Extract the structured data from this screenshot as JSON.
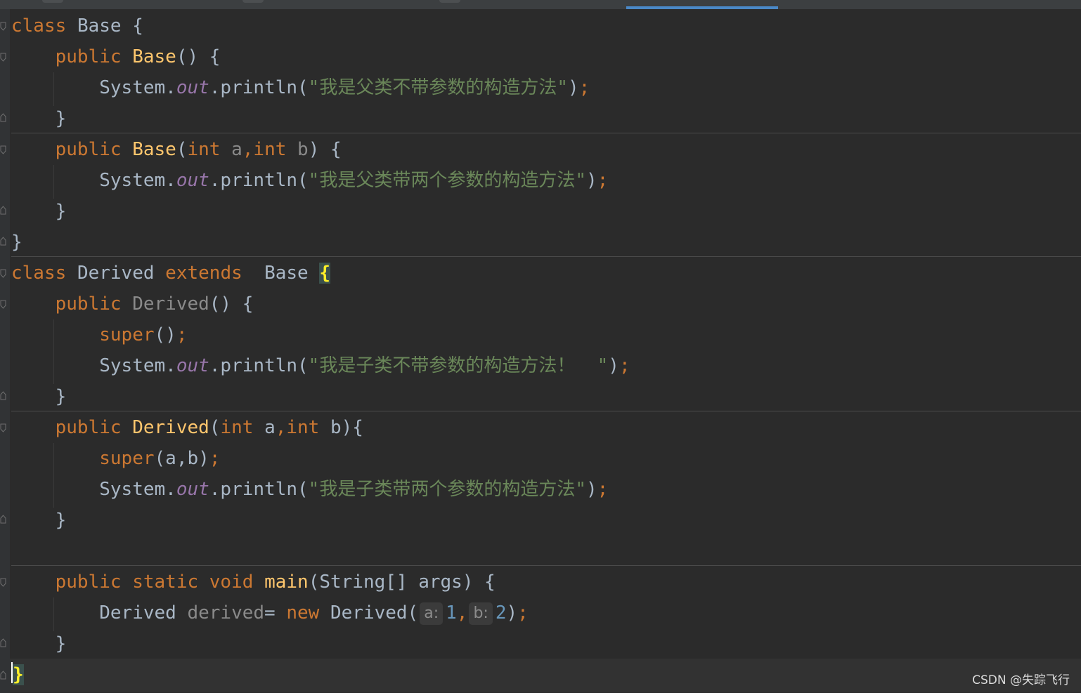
{
  "editor": {
    "lines": {
      "l1": {
        "kw": "class",
        "name": "Base",
        "brace": "{"
      },
      "l2": {
        "kw": "public",
        "name": "Base",
        "rest": "() {"
      },
      "l3": {
        "obj": "System.",
        "field": "out",
        "call": ".println(",
        "str": "\"我是父类不带参数的构造方法\"",
        "close": ")",
        "semi": ";"
      },
      "l4": {
        "text": "}"
      },
      "l5": {
        "kw": "public",
        "name": "Base",
        "p1": "(",
        "t1": "int",
        "a1": "a",
        "comma": ",",
        "t2": "int",
        "a2": "b",
        "rest": ") {"
      },
      "l6": {
        "obj": "System.",
        "field": "out",
        "call": ".println(",
        "str": "\"我是父类带两个参数的构造方法\"",
        "close": ")",
        "semi": ";"
      },
      "l7": {
        "text": "}"
      },
      "l8": {
        "text": "}"
      },
      "l9": {
        "kw": "class",
        "name": "Derived",
        "kw2": "extends",
        "base": "Base",
        "brace": "{"
      },
      "l10": {
        "kw": "public",
        "name": "Derived",
        "rest": "() {"
      },
      "l11": {
        "kw": "super",
        "rest": "()",
        "semi": ";"
      },
      "l12": {
        "obj": "System.",
        "field": "out",
        "call": ".println(",
        "str": "\"我是子类不带参数的构造方法！  \"",
        "close": ")",
        "semi": ";"
      },
      "l13": {
        "text": "}"
      },
      "l14": {
        "kw": "public",
        "name": "Derived",
        "p1": "(",
        "t1": "int",
        "a1": "a",
        "comma": ",",
        "t2": "int",
        "a2": "b){"
      },
      "l15": {
        "kw": "super",
        "rest": "(a,b)",
        "semi": ";"
      },
      "l16": {
        "obj": "System.",
        "field": "out",
        "call": ".println(",
        "str": "\"我是子类带两个参数的构造方法\"",
        "close": ")",
        "semi": ";"
      },
      "l17": {
        "text": "}"
      },
      "l19": {
        "kw": "public",
        "kw2": "static",
        "kw3": "void",
        "name": "main",
        "rest": "(String[] args) {"
      },
      "l20": {
        "type": "Derived",
        "var": "derived",
        "eq": "=",
        "kw": "new",
        "call": "Derived(",
        "hint_a": "a:",
        "val_a": "1",
        "comma": ",",
        "hint_b": "b:",
        "val_b": "2",
        "close": ")",
        "semi": ";"
      },
      "l21": {
        "text": "}"
      },
      "l22": {
        "text": "}"
      }
    }
  },
  "watermark": "CSDN @失踪飞行",
  "colors": {
    "background": "#2b2b2b",
    "keyword": "#cc7832",
    "function": "#ffc66d",
    "string": "#6a8759",
    "static_field": "#9876aa",
    "number": "#6897bb",
    "text": "#a9b7c6",
    "tab_underline": "#4a88c7"
  }
}
